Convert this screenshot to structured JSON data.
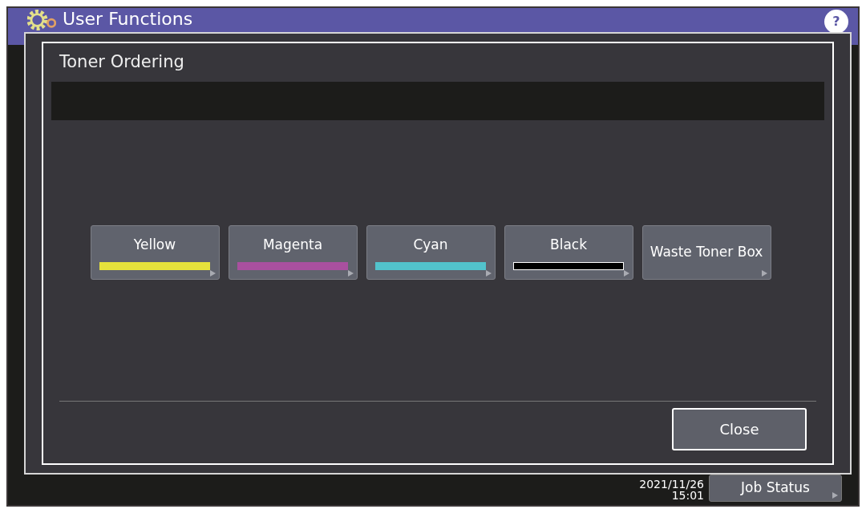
{
  "header": {
    "title": "User Functions",
    "help": "?"
  },
  "dialog": {
    "title": "Toner Ordering",
    "buttons": [
      {
        "label": "Yellow",
        "kind": "toner",
        "color": "#e6e23c"
      },
      {
        "label": "Magenta",
        "kind": "toner",
        "color": "#a9509f"
      },
      {
        "label": "Cyan",
        "kind": "toner",
        "color": "#52c3cc"
      },
      {
        "label": "Black",
        "kind": "toner",
        "color": "#000000"
      },
      {
        "label": "Waste Toner Box",
        "kind": "plain"
      }
    ],
    "close": "Close"
  },
  "status_bar": {
    "date": "2021/11/26",
    "time": "15:01",
    "job_status": "Job Status"
  }
}
